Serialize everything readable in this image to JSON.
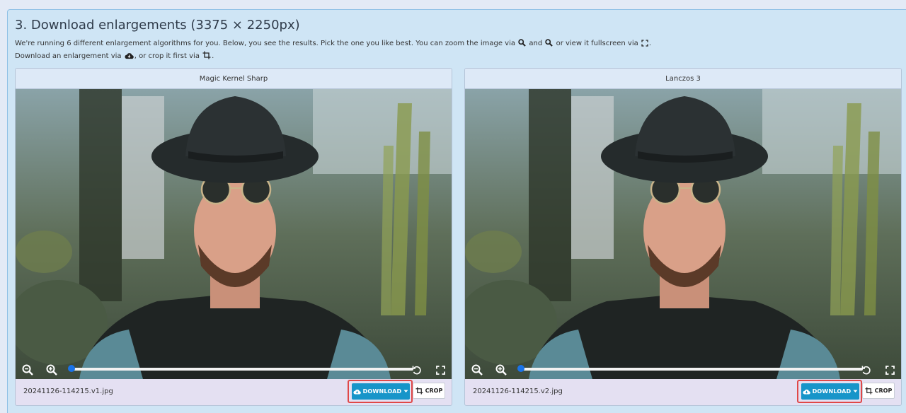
{
  "section": {
    "title": "3. Download enlargements (3375 × 2250px)",
    "desc_part1": "We're running 6 different enlargement algorithms for you. Below, you see the results. Pick the one you like best. You can zoom the image via",
    "desc_and": "and",
    "desc_part2": "or view it fullscreen via",
    "desc_period": ".",
    "desc_line2_part1": "Download an enlargement via",
    "desc_line2_part2": ", or crop it first via",
    "desc_line2_end": "."
  },
  "panels": [
    {
      "title": "Magic Kernel Sharp",
      "filename": "20241126-114215.v1.jpg",
      "download_label": "DOWNLOAD",
      "crop_label": "CROP",
      "zoom_level": 0
    },
    {
      "title": "Lanczos 3",
      "filename": "20241126-114215.v2.jpg",
      "download_label": "DOWNLOAD",
      "crop_label": "CROP",
      "zoom_level": 0
    }
  ],
  "icons": {
    "zoom_out": "zoom-out-icon",
    "zoom_in": "zoom-in-icon",
    "reset": "reset-icon",
    "fullscreen": "fullscreen-icon",
    "download": "cloud-download-icon",
    "crop": "crop-icon",
    "caret": "caret-down-icon"
  },
  "colors": {
    "download_button": "#1795c9",
    "highlight_border": "#e04848",
    "slider_knob": "#1a73e8"
  }
}
